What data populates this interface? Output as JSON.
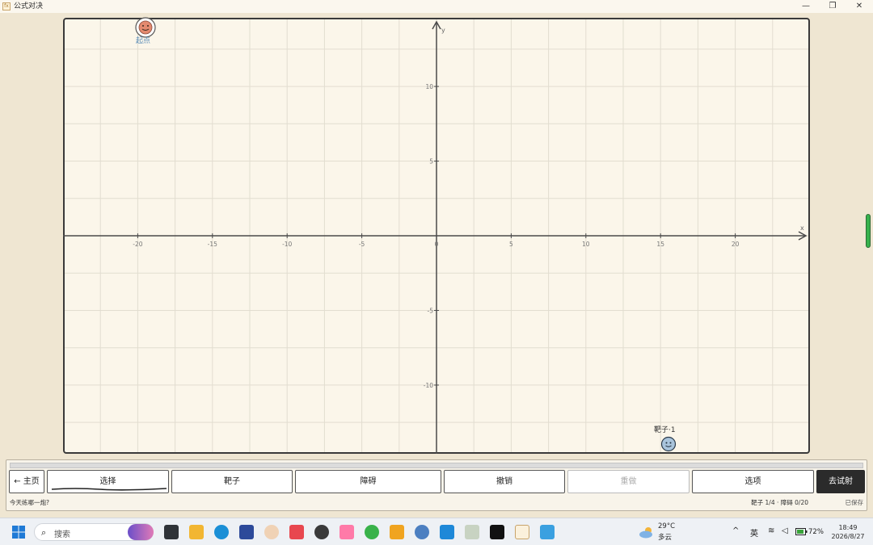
{
  "window": {
    "title": "公式对决",
    "app_icon": "fx-icon",
    "controls": [
      "minimize-icon",
      "restore-icon",
      "close-icon"
    ]
  },
  "board": {
    "start_label": "起点",
    "target_label": "靶子·1",
    "start_point": {
      "x": -20,
      "y": 14
    },
    "target_point": {
      "x": 15.5,
      "y": -14
    },
    "axis_x_label": "x",
    "axis_y_label": "y",
    "x_ticks": [
      -20,
      -15,
      -10,
      -5,
      0,
      5,
      10,
      15,
      20
    ],
    "y_ticks": [
      10,
      5,
      -5,
      -10
    ],
    "x_range": [
      -25,
      25
    ],
    "y_range": [
      -14.6,
      14.6
    ],
    "grid_step": 2.5,
    "grid": true
  },
  "toolbar": {
    "home": "← 主页",
    "select": "选择",
    "target": "靶子",
    "obstacle": "障碍",
    "undo": "撤销",
    "redo": "重做",
    "options": "选项",
    "fire": "去试射"
  },
  "status": {
    "hint": "今天练哪一炮?",
    "counts": "靶子 1/4 · 障碍 0/20",
    "saved": "已保存"
  },
  "taskbar": {
    "search_placeholder": "搜索",
    "weather_temp": "29°C",
    "weather_cond": "多云",
    "ime": "英",
    "battery": "72%",
    "time": "18:49",
    "date": "2026/8/27"
  },
  "colors": {
    "paper": "#fbf6ea",
    "grid": "#e2ddd0",
    "axis": "#4a4a4a",
    "start": "#e38a6f",
    "target": "#a9c4dc",
    "fire_button": "#2b2b2b"
  }
}
